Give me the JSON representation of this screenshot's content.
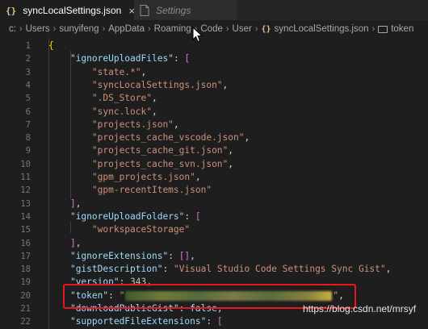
{
  "tabs": [
    {
      "icon": "{}",
      "label": "syncLocalSettings.json",
      "close": "×"
    },
    {
      "label": "Settings"
    }
  ],
  "breadcrumb": [
    "c:",
    "Users",
    "sunyifeng",
    "AppData",
    "Roaming",
    "Code",
    "User",
    "syncLocalSettings.json",
    "token"
  ],
  "breadcrumb_sep": "›",
  "editor": {
    "lines": [
      {
        "n": "1",
        "parts": [
          [
            "b1",
            "{"
          ]
        ]
      },
      {
        "n": "2",
        "parts": [
          [
            "p",
            "    "
          ],
          [
            "k",
            "\"ignoreUploadFiles\""
          ],
          [
            "p",
            ": "
          ],
          [
            "b2",
            "["
          ]
        ]
      },
      {
        "n": "3",
        "parts": [
          [
            "p",
            "        "
          ],
          [
            "s",
            "\"state.*\""
          ],
          [
            "p",
            ","
          ]
        ]
      },
      {
        "n": "4",
        "parts": [
          [
            "p",
            "        "
          ],
          [
            "s",
            "\"syncLocalSettings.json\""
          ],
          [
            "p",
            ","
          ]
        ]
      },
      {
        "n": "5",
        "parts": [
          [
            "p",
            "        "
          ],
          [
            "s",
            "\".DS_Store\""
          ],
          [
            "p",
            ","
          ]
        ]
      },
      {
        "n": "6",
        "parts": [
          [
            "p",
            "        "
          ],
          [
            "s",
            "\"sync.lock\""
          ],
          [
            "p",
            ","
          ]
        ]
      },
      {
        "n": "7",
        "parts": [
          [
            "p",
            "        "
          ],
          [
            "s",
            "\"projects.json\""
          ],
          [
            "p",
            ","
          ]
        ]
      },
      {
        "n": "8",
        "parts": [
          [
            "p",
            "        "
          ],
          [
            "s",
            "\"projects_cache_vscode.json\""
          ],
          [
            "p",
            ","
          ]
        ]
      },
      {
        "n": "9",
        "parts": [
          [
            "p",
            "        "
          ],
          [
            "s",
            "\"projects_cache_git.json\""
          ],
          [
            "p",
            ","
          ]
        ]
      },
      {
        "n": "10",
        "parts": [
          [
            "p",
            "        "
          ],
          [
            "s",
            "\"projects_cache_svn.json\""
          ],
          [
            "p",
            ","
          ]
        ]
      },
      {
        "n": "11",
        "parts": [
          [
            "p",
            "        "
          ],
          [
            "s",
            "\"gpm_projects.json\""
          ],
          [
            "p",
            ","
          ]
        ]
      },
      {
        "n": "12",
        "parts": [
          [
            "p",
            "        "
          ],
          [
            "s",
            "\"gpm-recentItems.json\""
          ]
        ]
      },
      {
        "n": "13",
        "parts": [
          [
            "p",
            "    "
          ],
          [
            "b2",
            "]"
          ],
          [
            "p",
            ","
          ]
        ]
      },
      {
        "n": "14",
        "parts": [
          [
            "p",
            "    "
          ],
          [
            "k",
            "\"ignoreUploadFolders\""
          ],
          [
            "p",
            ": "
          ],
          [
            "b2",
            "["
          ]
        ]
      },
      {
        "n": "15",
        "parts": [
          [
            "p",
            "        "
          ],
          [
            "s",
            "\"workspaceStorage\""
          ]
        ]
      },
      {
        "n": "16",
        "parts": [
          [
            "p",
            "    "
          ],
          [
            "b2",
            "]"
          ],
          [
            "p",
            ","
          ]
        ]
      },
      {
        "n": "17",
        "parts": [
          [
            "p",
            "    "
          ],
          [
            "k",
            "\"ignoreExtensions\""
          ],
          [
            "p",
            ": "
          ],
          [
            "b2",
            "[]"
          ],
          [
            "p",
            ","
          ]
        ]
      },
      {
        "n": "18",
        "parts": [
          [
            "p",
            "    "
          ],
          [
            "k",
            "\"gistDescription\""
          ],
          [
            "p",
            ": "
          ],
          [
            "s",
            "\"Visual Studio Code Settings Sync Gist\""
          ],
          [
            "p",
            ","
          ]
        ]
      },
      {
        "n": "19",
        "parts": [
          [
            "p",
            "    "
          ],
          [
            "k",
            "\"version\""
          ],
          [
            "p",
            ": "
          ],
          [
            "n",
            "343"
          ],
          [
            "p",
            ","
          ]
        ]
      },
      {
        "n": "20",
        "parts": [
          [
            "p",
            "    "
          ],
          [
            "k",
            "\"token\""
          ],
          [
            "p",
            ": "
          ],
          [
            "s",
            "\""
          ],
          [
            "blur",
            ""
          ],
          [
            "s",
            "\""
          ],
          [
            "p",
            ","
          ]
        ]
      },
      {
        "n": "21",
        "parts": [
          [
            "p",
            "    "
          ],
          [
            "k",
            "\"downloadPublicGist\""
          ],
          [
            "p",
            ": "
          ],
          [
            "k",
            "false"
          ],
          [
            "p",
            ","
          ]
        ]
      },
      {
        "n": "22",
        "parts": [
          [
            "p",
            "    "
          ],
          [
            "k",
            "\"supportedFileExtensions\""
          ],
          [
            "p",
            ": "
          ],
          [
            "b2",
            "["
          ]
        ]
      }
    ]
  },
  "watermark": "https://blog.csdn.net/mrsyf",
  "colors": {
    "accent_red": "#e8171d",
    "key": "#9cdcfe",
    "string": "#ce9178",
    "number": "#b5cea8"
  }
}
